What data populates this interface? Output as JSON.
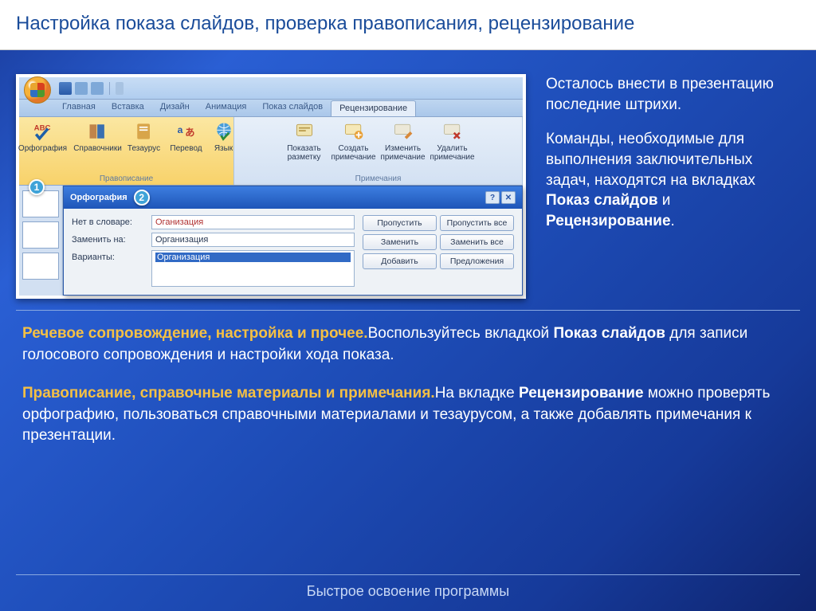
{
  "page": {
    "title": "Настройка показа слайдов, проверка правописания, рецензирование",
    "footer": "Быстрое освоение программы"
  },
  "sideText": {
    "p1": "Осталось внести в презентацию последние штрихи.",
    "p2a": "Команды, необходимые для выполнения заключительных задач, находятся на вкладках ",
    "p2b1": "Показ слайдов",
    "p2and": " и ",
    "p2b2": "Рецензирование",
    "p2end": "."
  },
  "bodyText": {
    "h1": "Речевое сопровождение, настройка и прочее.",
    "p1a": "Воспользуйтесь вкладкой ",
    "p1b": "Показ слайдов",
    "p1c": " для записи голосового сопровождения и настройки хода показа.",
    "h2": "Правописание, справочные материалы и примечания.",
    "p2a": "На вкладке ",
    "p2b": "Рецензирование",
    "p2c": " можно проверять орфографию, пользоваться справочными материалами и тезаурусом, а также добавлять примечания к презентации."
  },
  "ribbon": {
    "tabs": [
      "Главная",
      "Вставка",
      "Дизайн",
      "Анимация",
      "Показ слайдов",
      "Рецензирование"
    ],
    "activeTab": "Рецензирование",
    "groups": {
      "proofing": {
        "label": "Правописание",
        "items": {
          "spelling": "Орфография",
          "research": "Справочники",
          "thesaurus": "Тезаурус",
          "translate": "Перевод",
          "language": "Язык"
        }
      },
      "comments": {
        "label": "Примечания",
        "items": {
          "showMarkup": "Показать разметку",
          "new": "Создать примечание",
          "edit": "Изменить примечание",
          "delete": "Удалить примечание"
        }
      }
    }
  },
  "dialog": {
    "title": "Орфография",
    "labels": {
      "notInDict": "Нет в словаре:",
      "changeTo": "Заменить на:",
      "suggestions": "Варианты:"
    },
    "values": {
      "notInDict": "Оганизация",
      "changeTo": "Организация",
      "suggestion1": "Организация"
    },
    "buttons": {
      "ignore": "Пропустить",
      "ignoreAll": "Пропустить все",
      "change": "Заменить",
      "changeAll": "Заменить все",
      "add": "Добавить",
      "suggest": "Предложения"
    }
  },
  "callouts": {
    "c1": "1",
    "c2": "2"
  }
}
